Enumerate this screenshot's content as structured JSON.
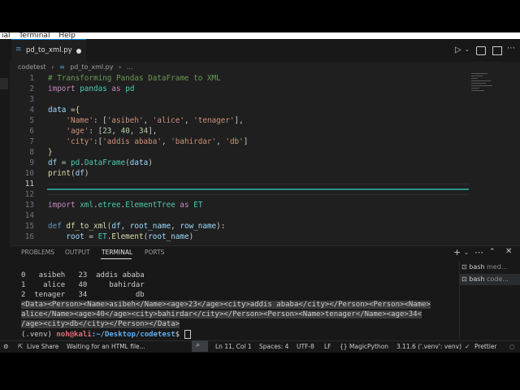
{
  "menu": {
    "items": [
      "ıal",
      "Terminal",
      "Help"
    ]
  },
  "tab": {
    "filename": "pd_to_xml.py"
  },
  "breadcrumb": {
    "folder": "codetest",
    "sep": "›",
    "file": "pd_to_xml.py",
    "more": "…"
  },
  "code": {
    "line_numbers": [
      "1",
      "2",
      "3",
      "4",
      "5",
      "6",
      "7",
      "8",
      "9",
      "10",
      "11",
      "12",
      "13",
      "14",
      "15",
      "16"
    ],
    "current_line": "11"
  },
  "panel": {
    "tabs": [
      "PROBLEMS",
      "OUTPUT",
      "TERMINAL",
      "PORTS"
    ],
    "active_tab": "TERMINAL",
    "terminal_lines": [
      "0   asibeh   23  addis ababa",
      "1    alice   40     bahirdar",
      "2  tenager   34           db"
    ],
    "xml_output": [
      "<Data><Person><Name>asibeh</Name><age>23</age><city>addis ababa</city></Person><Person><Name>",
      "alice</Name><age>40</age><city>bahirdar</city></Person><Person><Name>tenager</Name><age>34<",
      "/age><city>db</city></Person></Data>"
    ],
    "prompt_venv": "(.venv)",
    "prompt_user": "noh@kali",
    "prompt_path": ":~/Desktop/codetest",
    "prompt_sym": "$",
    "terminals": [
      {
        "name": "bash",
        "detail": "med..."
      },
      {
        "name": "bash",
        "detail": "code..."
      }
    ]
  },
  "status": {
    "live_share": "Live Share",
    "waiting": "Waiting for an HTML file...",
    "position": "Ln 11, Col 1",
    "spaces": "Spaces: 4",
    "encoding": "UTF-8",
    "eol": "LF",
    "language": "MagicPython",
    "interpreter": "3.11.6 ('.venv': venv)",
    "formatter": "Prettier"
  },
  "colors": {
    "accent": "#0078d4",
    "prompt_user": "#e06c75",
    "prompt_path": "#61afef"
  }
}
